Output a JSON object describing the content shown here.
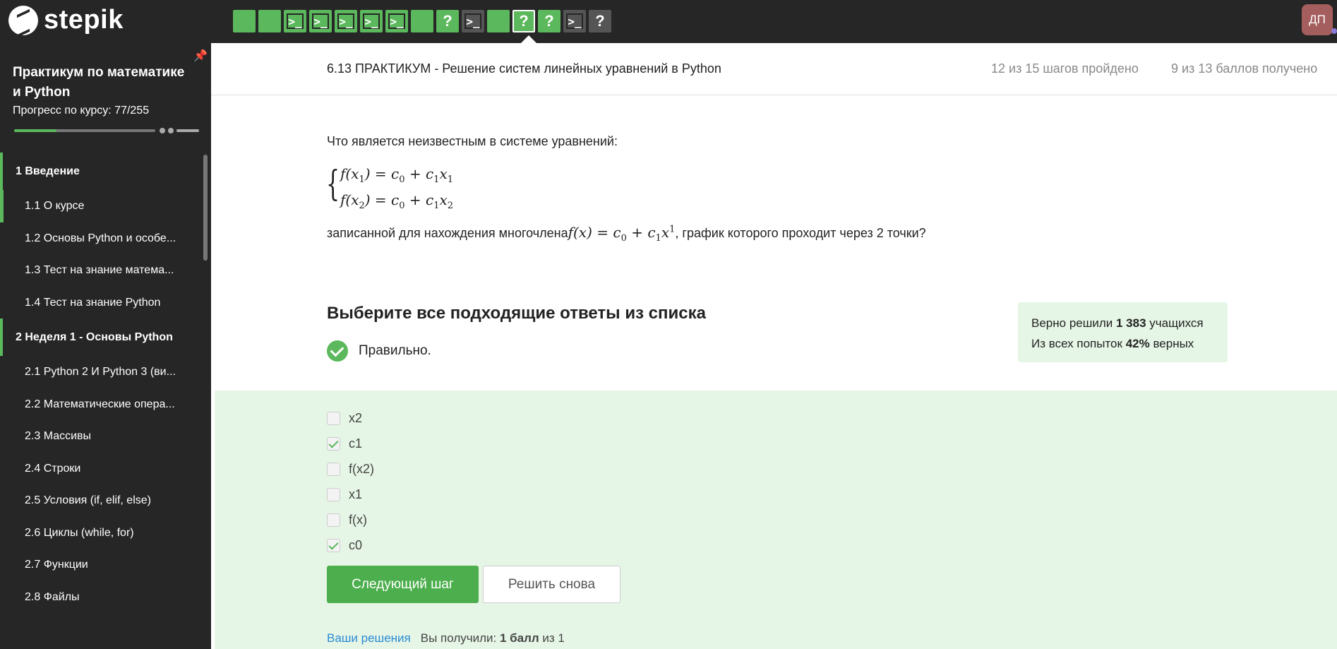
{
  "app": {
    "logo_text": "stepik",
    "avatar_initials": "ДП"
  },
  "topbar": {
    "steps": [
      {
        "type": "green",
        "glyph": ""
      },
      {
        "type": "green",
        "glyph": ""
      },
      {
        "type": "green",
        "glyph": "term"
      },
      {
        "type": "green",
        "glyph": "term"
      },
      {
        "type": "green",
        "glyph": "term"
      },
      {
        "type": "green",
        "glyph": "term"
      },
      {
        "type": "green",
        "glyph": "term"
      },
      {
        "type": "green",
        "glyph": ""
      },
      {
        "type": "green",
        "glyph": "?"
      },
      {
        "type": "gray",
        "glyph": "term"
      },
      {
        "type": "green",
        "glyph": ""
      },
      {
        "type": "current",
        "glyph": "?"
      },
      {
        "type": "green",
        "glyph": "?"
      },
      {
        "type": "gray",
        "glyph": "term"
      },
      {
        "type": "gray",
        "glyph": "?"
      }
    ]
  },
  "sidebar": {
    "course_title": "Практикум по математике и Python",
    "progress_label": "Прогресс по курсу:  77/255",
    "progress_fraction": 0.302,
    "sections": [
      {
        "title": "1  Введение",
        "lessons": [
          {
            "label": "1.1  О курсе",
            "active": true
          },
          {
            "label": "1.2  Основы Python и особе...",
            "active": false
          },
          {
            "label": "1.3  Тест на знание матема...",
            "active": false
          },
          {
            "label": "1.4  Тест на знание Python",
            "active": false
          }
        ]
      },
      {
        "title": "2  Неделя 1 - Основы Python",
        "lessons": [
          {
            "label": "2.1  Python 2 И Python 3 (ви...",
            "active": false
          },
          {
            "label": "2.2  Математические опера...",
            "active": false
          },
          {
            "label": "2.3  Массивы",
            "active": false
          },
          {
            "label": "2.4  Строки",
            "active": false
          },
          {
            "label": "2.5  Условия (if, elif, else)",
            "active": false
          },
          {
            "label": "2.6  Циклы (while, for)",
            "active": false
          },
          {
            "label": "2.7  Функции",
            "active": false
          },
          {
            "label": "2.8  Файлы",
            "active": false
          }
        ]
      }
    ]
  },
  "header": {
    "title": "6.13 ПРАКТИКУМ - Решение систем линейных уравнений в Python",
    "steps_done": "12 из 15 шагов пройдено",
    "score": "9 из 13 баллов  получено"
  },
  "question": {
    "text": "Что является неизвестным в системе уравнений:",
    "sentence_before": "записанной для нахождения многочлена",
    "sentence_after": ", график которого проходит через 2 точки?"
  },
  "answer": {
    "title": "Выберите все подходящие ответы из списка",
    "status": "Правильно.",
    "stats_line1_pre": "Верно решили ",
    "stats_line1_num": "1 383",
    "stats_line1_post": " учащихся",
    "stats_line2_pre": "Из всех попыток ",
    "stats_line2_num": "42%",
    "stats_line2_post": " верных",
    "options": [
      {
        "label": "x2",
        "checked": false
      },
      {
        "label": "c1",
        "checked": true
      },
      {
        "label": "f(x2)",
        "checked": false
      },
      {
        "label": "x1",
        "checked": false
      },
      {
        "label": "f(x)",
        "checked": false
      },
      {
        "label": "c0",
        "checked": true
      }
    ],
    "next_button": "Следующий шаг",
    "retry_button": "Решить снова",
    "solutions_link": "Ваши решения",
    "received_pre": "Вы получили: ",
    "received_bold": "1 балл",
    "received_post": " из 1"
  }
}
